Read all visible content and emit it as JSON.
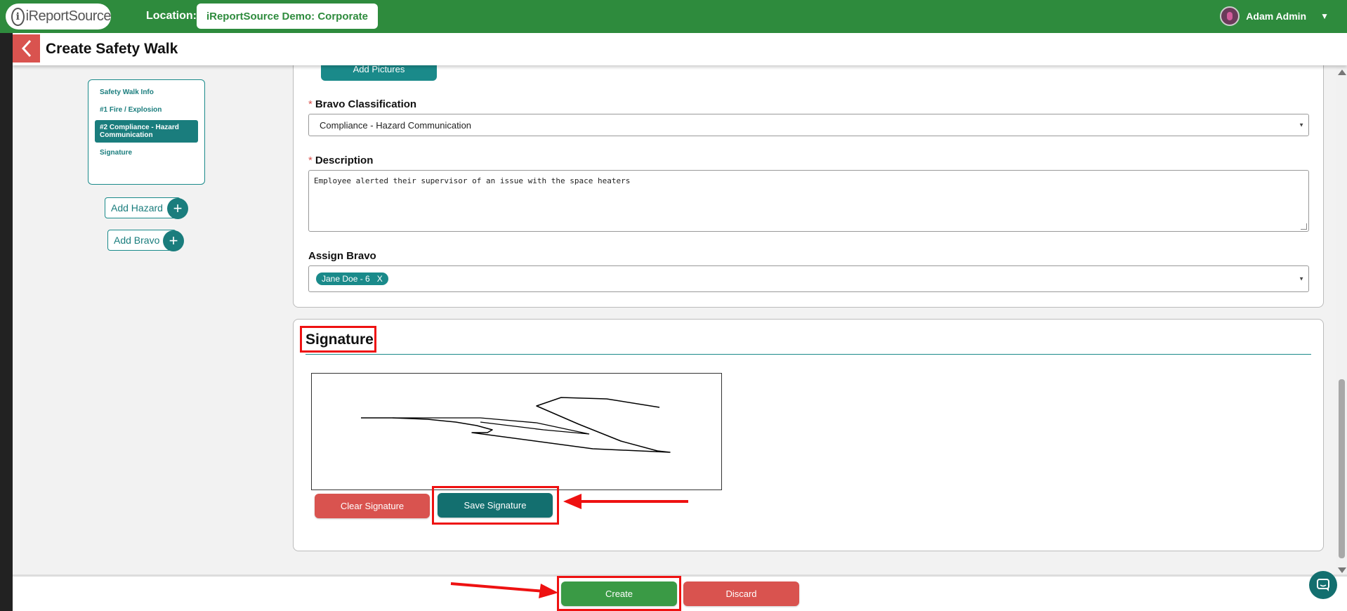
{
  "header": {
    "logo_text": "iReportSource",
    "location_label": "Location:",
    "location_value": "iReportSource Demo: Corporate",
    "user_name": "Adam Admin"
  },
  "page": {
    "title": "Create Safety Walk"
  },
  "section_nav": {
    "items": [
      {
        "label": "Safety Walk Info",
        "active": false
      },
      {
        "label": "#1 Fire / Explosion",
        "active": false
      },
      {
        "label": "#2 Compliance - Hazard Communication",
        "active": true
      },
      {
        "label": "Signature",
        "active": false
      }
    ]
  },
  "actions": {
    "add_hazard": "Add Hazard",
    "add_bravo": "Add Bravo",
    "plus": "+"
  },
  "form": {
    "add_pictures": "Add Pictures",
    "bravo_classification": {
      "label": "Bravo Classification",
      "required_mark": "*",
      "value": "Compliance - Hazard Communication"
    },
    "description": {
      "label": "Description",
      "required_mark": "*",
      "value": "Employee alerted their supervisor of an issue with the space heaters"
    },
    "assign_bravo": {
      "label": "Assign Bravo",
      "tag": "Jane Doe - 6",
      "tag_remove": "X"
    }
  },
  "signature": {
    "title": "Signature",
    "clear_label": "Clear Signature",
    "save_label": "Save Signature"
  },
  "footer": {
    "create_label": "Create",
    "discard_label": "Discard"
  },
  "colors": {
    "header_green": "#2e8b3d",
    "teal": "#1a7d7d",
    "danger": "#d9534f",
    "annotation": "#ee1111"
  }
}
